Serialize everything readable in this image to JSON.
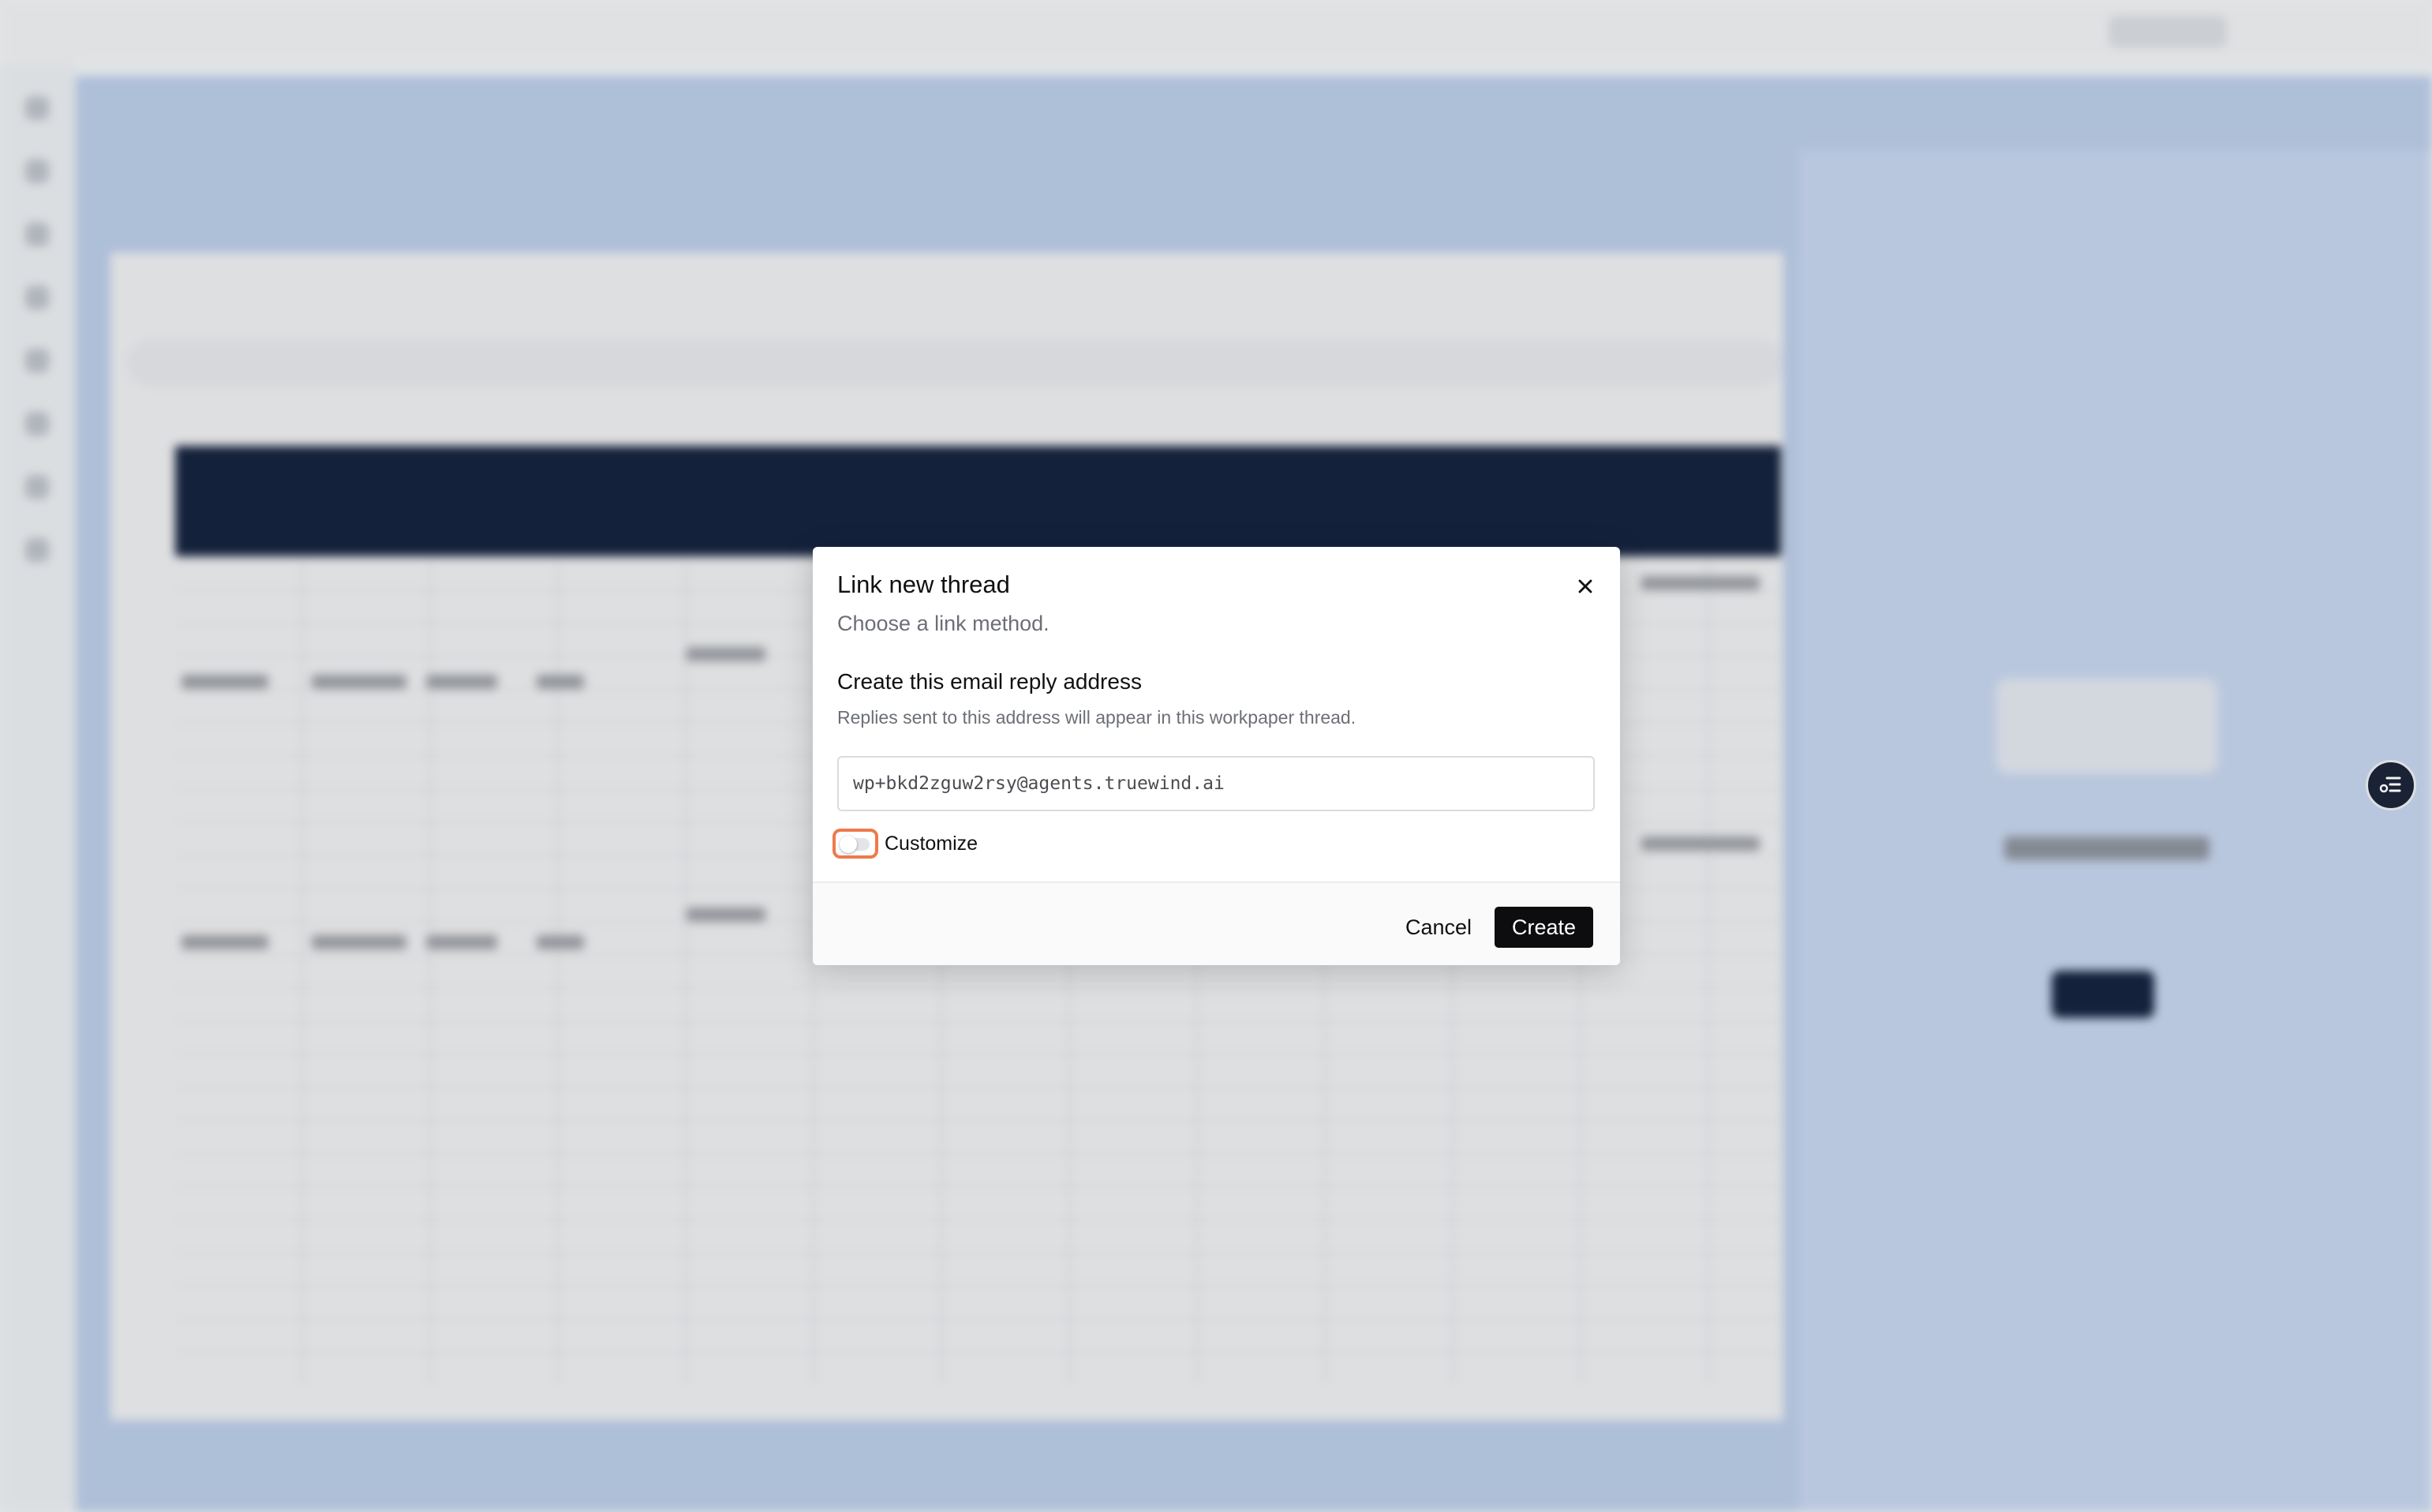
{
  "modal": {
    "title": "Link new thread",
    "subtitle": "Choose a link method.",
    "section_heading": "Create this email reply address",
    "section_help": "Replies sent to this address will appear in this workpaper thread.",
    "email_value": "wp+bkd2zguw2rsy@agents.truewind.ai",
    "customize_label": "Customize",
    "customize_on": false,
    "cancel_label": "Cancel",
    "create_label": "Create"
  },
  "icons": {
    "close": "close-icon",
    "fab": "list-settings-icon"
  },
  "colors": {
    "primary_button": "#0d0d0f",
    "focus_ring": "#ee7a4c",
    "sheet_header": "#14203c",
    "backdrop_blue": "#b7c8e3"
  }
}
